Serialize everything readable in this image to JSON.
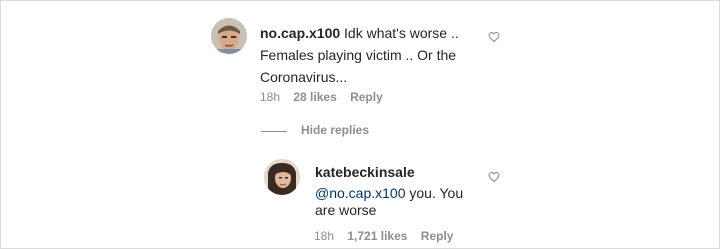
{
  "comment": {
    "username": "no.cap.x100",
    "text_line1": " Idk what's worse ..",
    "text_line2": "Females playing victim .. Or the",
    "text_line3": "Coronavirus...",
    "time": "18h",
    "likes": "28 likes",
    "reply_label": "Reply",
    "heart_icon": "heart-outline-icon"
  },
  "hide_replies_label": "Hide replies",
  "reply": {
    "username": "katebeckinsale",
    "mention": "@no.cap.x100",
    "text_line1_rest": " you. You",
    "text_line2": "are worse",
    "time": "18h",
    "likes": "1,721 likes",
    "reply_label": "Reply",
    "heart_icon": "heart-outline-icon"
  }
}
